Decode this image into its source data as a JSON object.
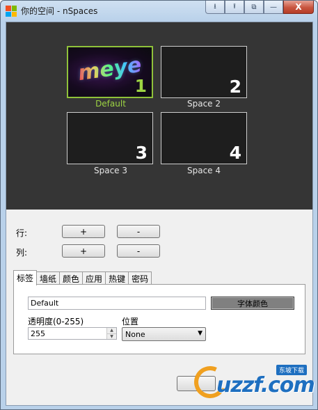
{
  "window": {
    "title": "你的空间 - nSpaces",
    "buttons": [
      "⭳",
      "⭱",
      "⧉",
      "—",
      "X"
    ]
  },
  "spaces": [
    {
      "label": "Default",
      "number": "1",
      "selected": true,
      "thumbnail_text": "meye"
    },
    {
      "label": "Space 2",
      "number": "2",
      "selected": false
    },
    {
      "label": "Space 3",
      "number": "3",
      "selected": false
    },
    {
      "label": "Space 4",
      "number": "4",
      "selected": false
    }
  ],
  "rows": {
    "label": "行:",
    "add": "+",
    "remove": "-"
  },
  "cols": {
    "label": "列:",
    "add": "+",
    "remove": "-"
  },
  "tabs": [
    {
      "label": "标签",
      "active": true
    },
    {
      "label": "墙纸",
      "active": false
    },
    {
      "label": "颜色",
      "active": false
    },
    {
      "label": "应用",
      "active": false
    },
    {
      "label": "热键",
      "active": false
    },
    {
      "label": "密码",
      "active": false
    }
  ],
  "label_tab": {
    "name_value": "Default",
    "font_color_button": "字体颜色",
    "opacity_label": "透明度(0-255)",
    "opacity_value": "255",
    "position_label": "位置",
    "position_value": "None"
  },
  "watermark": {
    "text": "uzzf.com",
    "badge": "东坡下载"
  },
  "colors": {
    "accent_green": "#9dd443",
    "panel_dark": "#353535",
    "watermark_blue": "#1e6fc0"
  }
}
